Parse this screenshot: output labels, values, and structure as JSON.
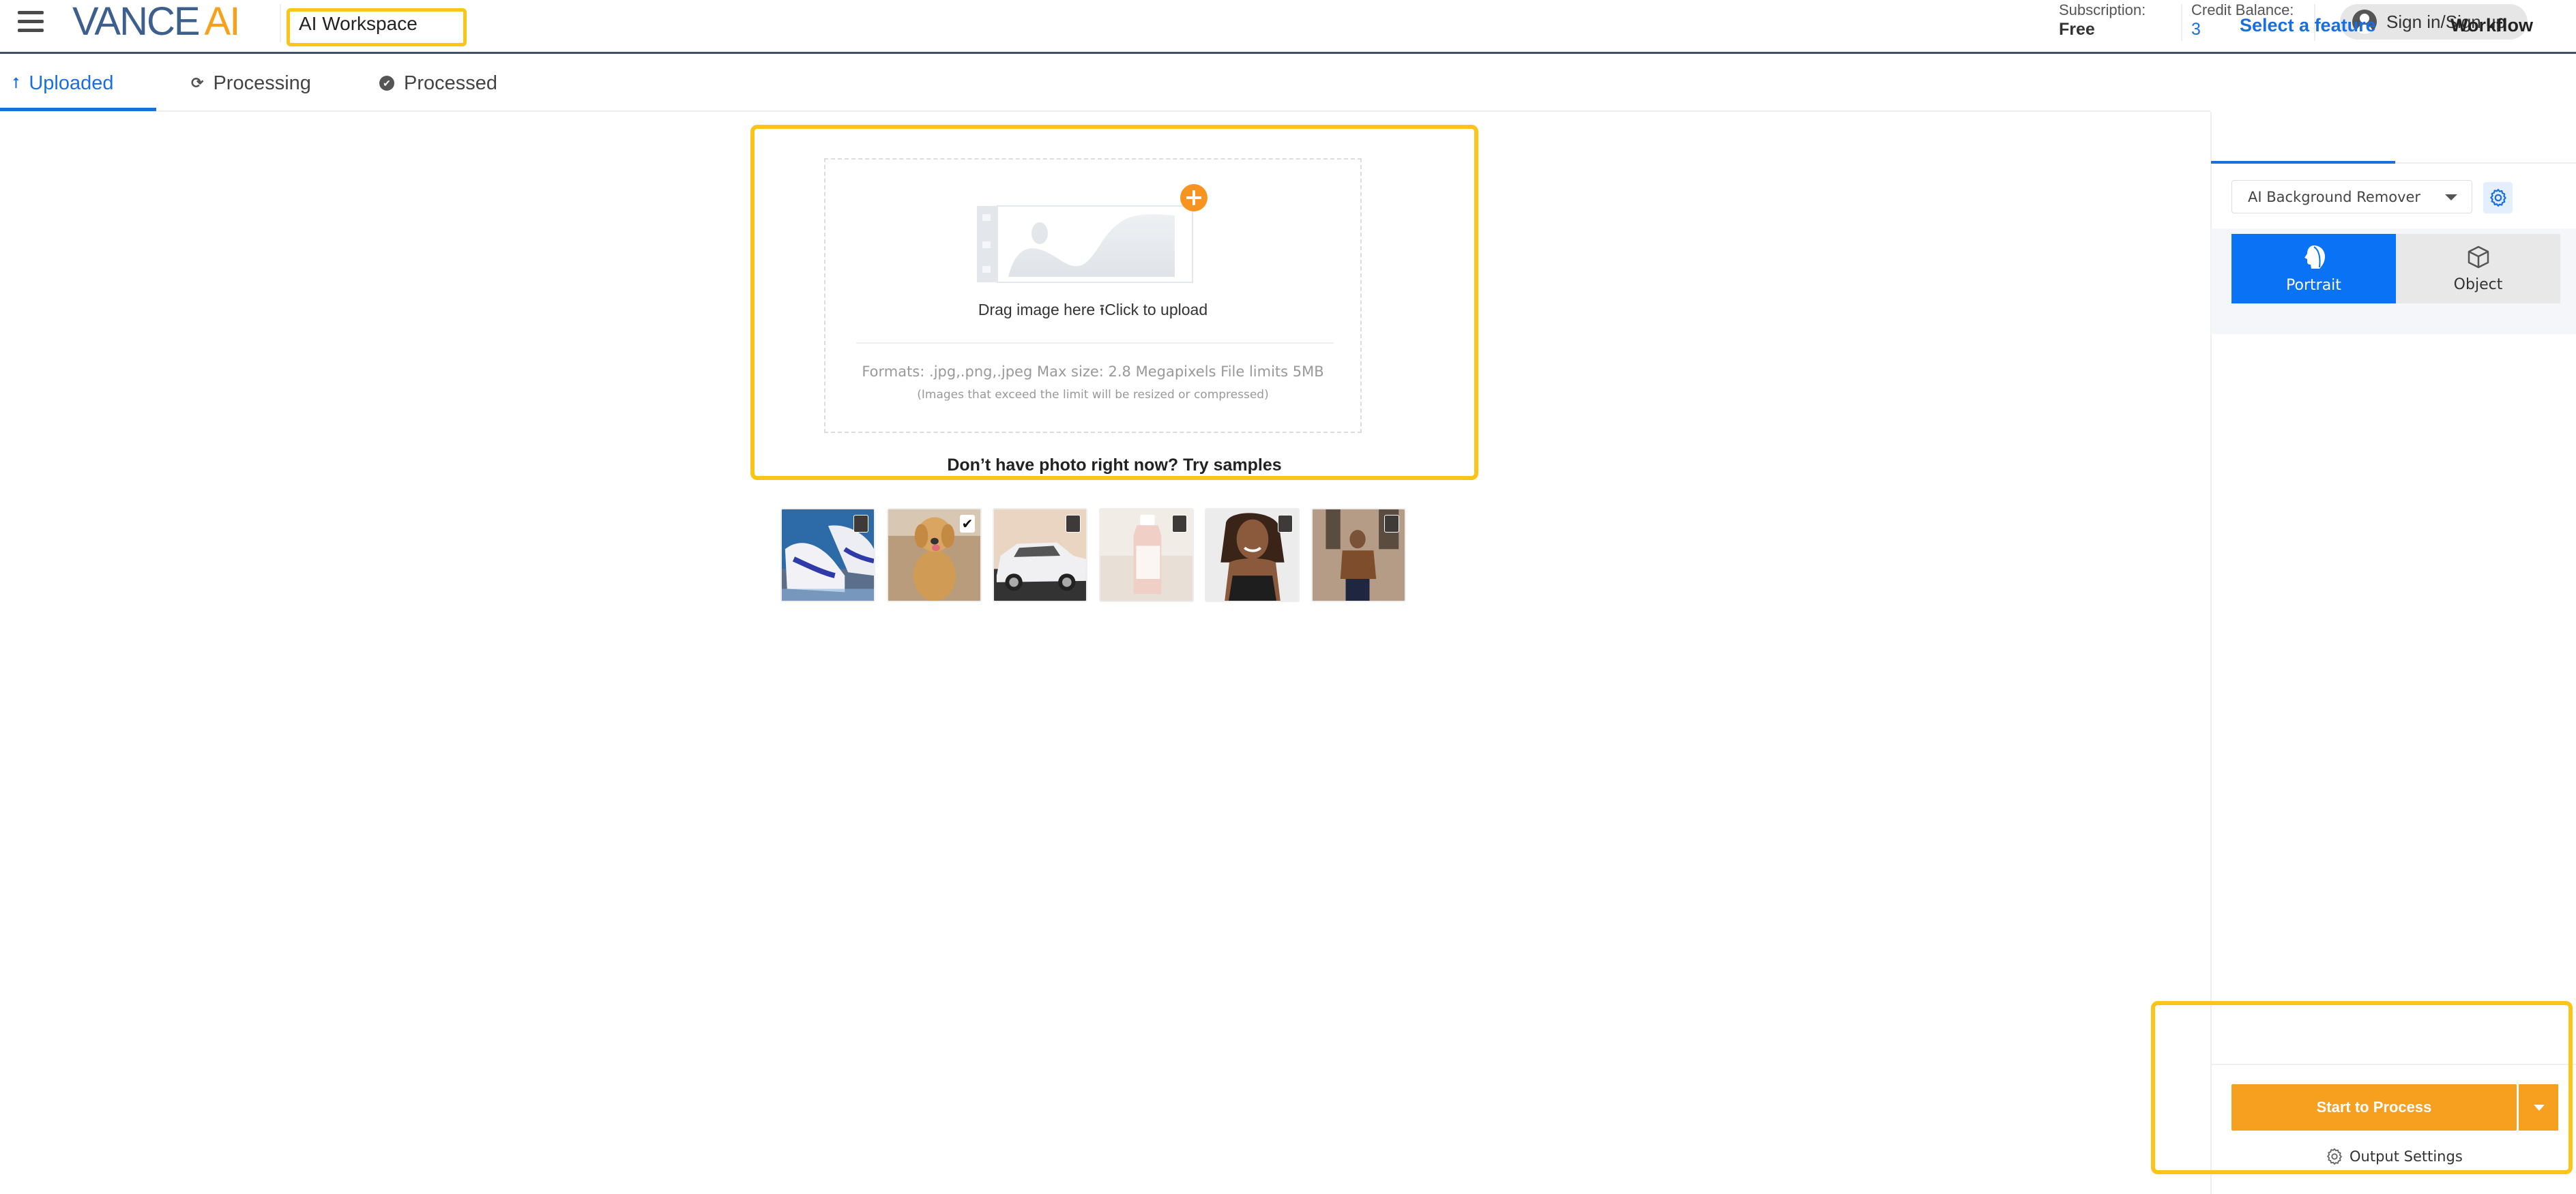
{
  "header": {
    "logo_primary": "VANCE",
    "logo_accent": "AI",
    "workspace_title": "AI Workspace",
    "subscription_label": "Subscription:",
    "subscription_value": "Free",
    "credit_label": "Credit Balance:",
    "credit_value": "3",
    "signin_label": "Sign in/Sign up",
    "icons": {
      "menu": "hamburger-menu-icon",
      "account": "user-avatar-icon"
    }
  },
  "status_tabs": [
    {
      "label": "Uploaded",
      "icon": "upload-arrow-icon",
      "glyph": "⭡",
      "active": true
    },
    {
      "label": "Processing",
      "icon": "refresh-icon",
      "glyph": "⟳",
      "active": false
    },
    {
      "label": "Processed",
      "icon": "check-circle-icon",
      "glyph": "✔",
      "active": false
    }
  ],
  "upload": {
    "drag_text": "Drag image here",
    "click_text": "Click to upload",
    "formats_text": "Formats: .jpg,.png,.jpeg Max size: 2.8 Megapixels File limits 5MB",
    "formats_note": "(Images that exceed the limit will be resized or compressed)",
    "samples_prompt": "Don’t have photo right now? Try samples"
  },
  "samples": [
    {
      "name": "sneakers",
      "selected": false
    },
    {
      "name": "golden-retriever-puppy",
      "selected": true
    },
    {
      "name": "white-car",
      "selected": false
    },
    {
      "name": "cosmetic-bottle",
      "selected": false
    },
    {
      "name": "smiling-woman",
      "selected": false
    },
    {
      "name": "man-in-street",
      "selected": false
    }
  ],
  "right_panel": {
    "tabs": [
      {
        "label": "Select a feature",
        "active": true
      },
      {
        "label": "Workflow",
        "active": false
      }
    ],
    "feature_select": {
      "value": "AI Background Remover"
    },
    "modes": [
      {
        "label": "Portrait",
        "icon": "portrait-head-icon",
        "active": true
      },
      {
        "label": "Object",
        "icon": "cube-icon",
        "active": false
      }
    ],
    "start_button": "Start to Process",
    "output_settings": "Output Settings"
  },
  "colors": {
    "brand_blue": "#1a6fe0",
    "brand_orange": "#f79f1f",
    "highlight_yellow": "#fcc419",
    "portrait_blue": "#0a72f5"
  }
}
